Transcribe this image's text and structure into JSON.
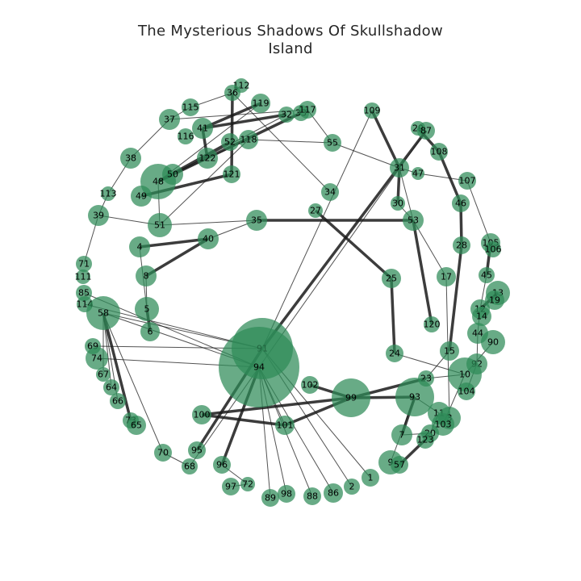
{
  "title_line1": "The Mysterious Shadows Of Skullshadow",
  "title_line2": "Island",
  "colors": {
    "node_fill": "#2e8b57",
    "edge": "#1a1a1a",
    "label": "#000000"
  },
  "nodes": [
    {
      "id": "112"
    },
    {
      "id": "36"
    },
    {
      "id": "119"
    },
    {
      "id": "115"
    },
    {
      "id": "37"
    },
    {
      "id": "32"
    },
    {
      "id": "33"
    },
    {
      "id": "117"
    },
    {
      "id": "41"
    },
    {
      "id": "116"
    },
    {
      "id": "52"
    },
    {
      "id": "118"
    },
    {
      "id": "55"
    },
    {
      "id": "109"
    },
    {
      "id": "29"
    },
    {
      "id": "87"
    },
    {
      "id": "108"
    },
    {
      "id": "38"
    },
    {
      "id": "122"
    },
    {
      "id": "48"
    },
    {
      "id": "50"
    },
    {
      "id": "121"
    },
    {
      "id": "31"
    },
    {
      "id": "47"
    },
    {
      "id": "107"
    },
    {
      "id": "113"
    },
    {
      "id": "49"
    },
    {
      "id": "34"
    },
    {
      "id": "30"
    },
    {
      "id": "46"
    },
    {
      "id": "39"
    },
    {
      "id": "51"
    },
    {
      "id": "35"
    },
    {
      "id": "27"
    },
    {
      "id": "53"
    },
    {
      "id": "40"
    },
    {
      "id": "4"
    },
    {
      "id": "28"
    },
    {
      "id": "105"
    },
    {
      "id": "106"
    },
    {
      "id": "71"
    },
    {
      "id": "111"
    },
    {
      "id": "8"
    },
    {
      "id": "25"
    },
    {
      "id": "17"
    },
    {
      "id": "45"
    },
    {
      "id": "13"
    },
    {
      "id": "85"
    },
    {
      "id": "114"
    },
    {
      "id": "58"
    },
    {
      "id": "5"
    },
    {
      "id": "19"
    },
    {
      "id": "12"
    },
    {
      "id": "14"
    },
    {
      "id": "6"
    },
    {
      "id": "120"
    },
    {
      "id": "44"
    },
    {
      "id": "90"
    },
    {
      "id": "69"
    },
    {
      "id": "74"
    },
    {
      "id": "91"
    },
    {
      "id": "24"
    },
    {
      "id": "15"
    },
    {
      "id": "92"
    },
    {
      "id": "94"
    },
    {
      "id": "67"
    },
    {
      "id": "23"
    },
    {
      "id": "10"
    },
    {
      "id": "64"
    },
    {
      "id": "102"
    },
    {
      "id": "104"
    },
    {
      "id": "66"
    },
    {
      "id": "99"
    },
    {
      "id": "93"
    },
    {
      "id": "100"
    },
    {
      "id": "11"
    },
    {
      "id": "3"
    },
    {
      "id": "73"
    },
    {
      "id": "65"
    },
    {
      "id": "101"
    },
    {
      "id": "103"
    },
    {
      "id": "20"
    },
    {
      "id": "7"
    },
    {
      "id": "123"
    },
    {
      "id": "95"
    },
    {
      "id": "70"
    },
    {
      "id": "9"
    },
    {
      "id": "57"
    },
    {
      "id": "96"
    },
    {
      "id": "68"
    },
    {
      "id": "1"
    },
    {
      "id": "2"
    },
    {
      "id": "72"
    },
    {
      "id": "97"
    },
    {
      "id": "86"
    },
    {
      "id": "98"
    },
    {
      "id": "89"
    },
    {
      "id": "88"
    }
  ],
  "edges": [
    [
      "112",
      "36"
    ],
    [
      "36",
      "121"
    ],
    [
      "36",
      "34"
    ],
    [
      "119",
      "41"
    ],
    [
      "119",
      "48"
    ],
    [
      "115",
      "37"
    ],
    [
      "115",
      "36"
    ],
    [
      "37",
      "38"
    ],
    [
      "38",
      "113"
    ],
    [
      "113",
      "39"
    ],
    [
      "32",
      "41"
    ],
    [
      "32",
      "50"
    ],
    [
      "33",
      "48"
    ],
    [
      "117",
      "37"
    ],
    [
      "117",
      "55"
    ],
    [
      "41",
      "122"
    ],
    [
      "52",
      "48"
    ],
    [
      "118",
      "122"
    ],
    [
      "118",
      "55"
    ],
    [
      "118",
      "51"
    ],
    [
      "55",
      "31"
    ],
    [
      "109",
      "31"
    ],
    [
      "29",
      "108"
    ],
    [
      "87",
      "94"
    ],
    [
      "87",
      "91"
    ],
    [
      "108",
      "46"
    ],
    [
      "122",
      "48"
    ],
    [
      "121",
      "49"
    ],
    [
      "31",
      "30"
    ],
    [
      "31",
      "53"
    ],
    [
      "31",
      "47"
    ],
    [
      "47",
      "107"
    ],
    [
      "107",
      "105"
    ],
    [
      "30",
      "53"
    ],
    [
      "53",
      "17"
    ],
    [
      "46",
      "28"
    ],
    [
      "39",
      "51"
    ],
    [
      "39",
      "71"
    ],
    [
      "51",
      "35"
    ],
    [
      "51",
      "48"
    ],
    [
      "35",
      "53"
    ],
    [
      "35",
      "40"
    ],
    [
      "27",
      "25"
    ],
    [
      "53",
      "120"
    ],
    [
      "40",
      "8"
    ],
    [
      "4",
      "40"
    ],
    [
      "4",
      "5"
    ],
    [
      "8",
      "5"
    ],
    [
      "5",
      "6"
    ],
    [
      "28",
      "15"
    ],
    [
      "105",
      "45"
    ],
    [
      "45",
      "12"
    ],
    [
      "17",
      "3"
    ],
    [
      "25",
      "24"
    ],
    [
      "24",
      "10"
    ],
    [
      "13",
      "12"
    ],
    [
      "12",
      "44"
    ],
    [
      "44",
      "92"
    ],
    [
      "90",
      "10"
    ],
    [
      "15",
      "23"
    ],
    [
      "92",
      "104"
    ],
    [
      "58",
      "91"
    ],
    [
      "58",
      "94"
    ],
    [
      "58",
      "73"
    ],
    [
      "58",
      "70"
    ],
    [
      "114",
      "91"
    ],
    [
      "85",
      "94"
    ],
    [
      "74",
      "94"
    ],
    [
      "69",
      "91"
    ],
    [
      "67",
      "58"
    ],
    [
      "64",
      "58"
    ],
    [
      "66",
      "58"
    ],
    [
      "100",
      "101"
    ],
    [
      "100",
      "99"
    ],
    [
      "101",
      "99"
    ],
    [
      "102",
      "99"
    ],
    [
      "99",
      "93"
    ],
    [
      "99",
      "23"
    ],
    [
      "93",
      "11"
    ],
    [
      "93",
      "7"
    ],
    [
      "93",
      "9"
    ],
    [
      "23",
      "10"
    ],
    [
      "10",
      "103"
    ],
    [
      "11",
      "20"
    ],
    [
      "20",
      "123"
    ],
    [
      "7",
      "20"
    ],
    [
      "9",
      "57"
    ],
    [
      "57",
      "123"
    ],
    [
      "95",
      "91"
    ],
    [
      "96",
      "94"
    ],
    [
      "68",
      "94"
    ],
    [
      "70",
      "68"
    ],
    [
      "97",
      "72"
    ],
    [
      "72",
      "96"
    ],
    [
      "94",
      "89"
    ],
    [
      "94",
      "98"
    ],
    [
      "94",
      "88"
    ],
    [
      "94",
      "86"
    ],
    [
      "91",
      "2"
    ],
    [
      "91",
      "1"
    ],
    [
      "94",
      "101"
    ],
    [
      "91",
      "109"
    ]
  ]
}
